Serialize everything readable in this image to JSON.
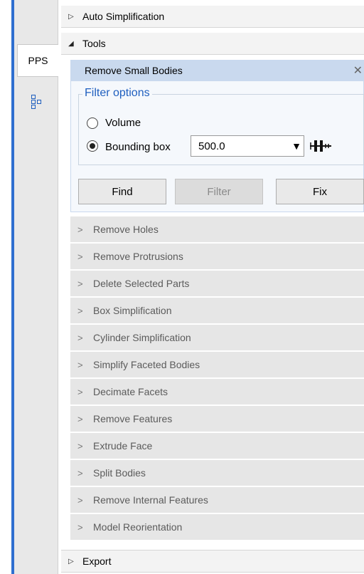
{
  "tabs": {
    "pps_label": "PPS",
    "structure_icon": "structure-tree-icon"
  },
  "sections": {
    "auto_simplification": "Auto Simplification",
    "tools": "Tools",
    "export": "Export"
  },
  "remove_small_bodies": {
    "title": "Remove Small Bodies",
    "close_icon": "close-icon",
    "filter_group_label": "Filter options",
    "radio_volume": "Volume",
    "radio_bounding_box": "Bounding box",
    "selected": "Bounding box",
    "value": "500.0",
    "units_icon": "ruler-icon",
    "buttons": {
      "find": "Find",
      "filter": "Filter",
      "fix": "Fix"
    }
  },
  "tools": [
    "Remove Holes",
    "Remove Protrusions",
    "Delete Selected Parts",
    "Box Simplification",
    "Cylinder Simplification",
    "Simplify Faceted Bodies",
    "Decimate Facets",
    "Remove Features",
    "Extrude Face",
    "Split Bodies",
    "Remove Internal Features",
    "Model Reorientation"
  ]
}
